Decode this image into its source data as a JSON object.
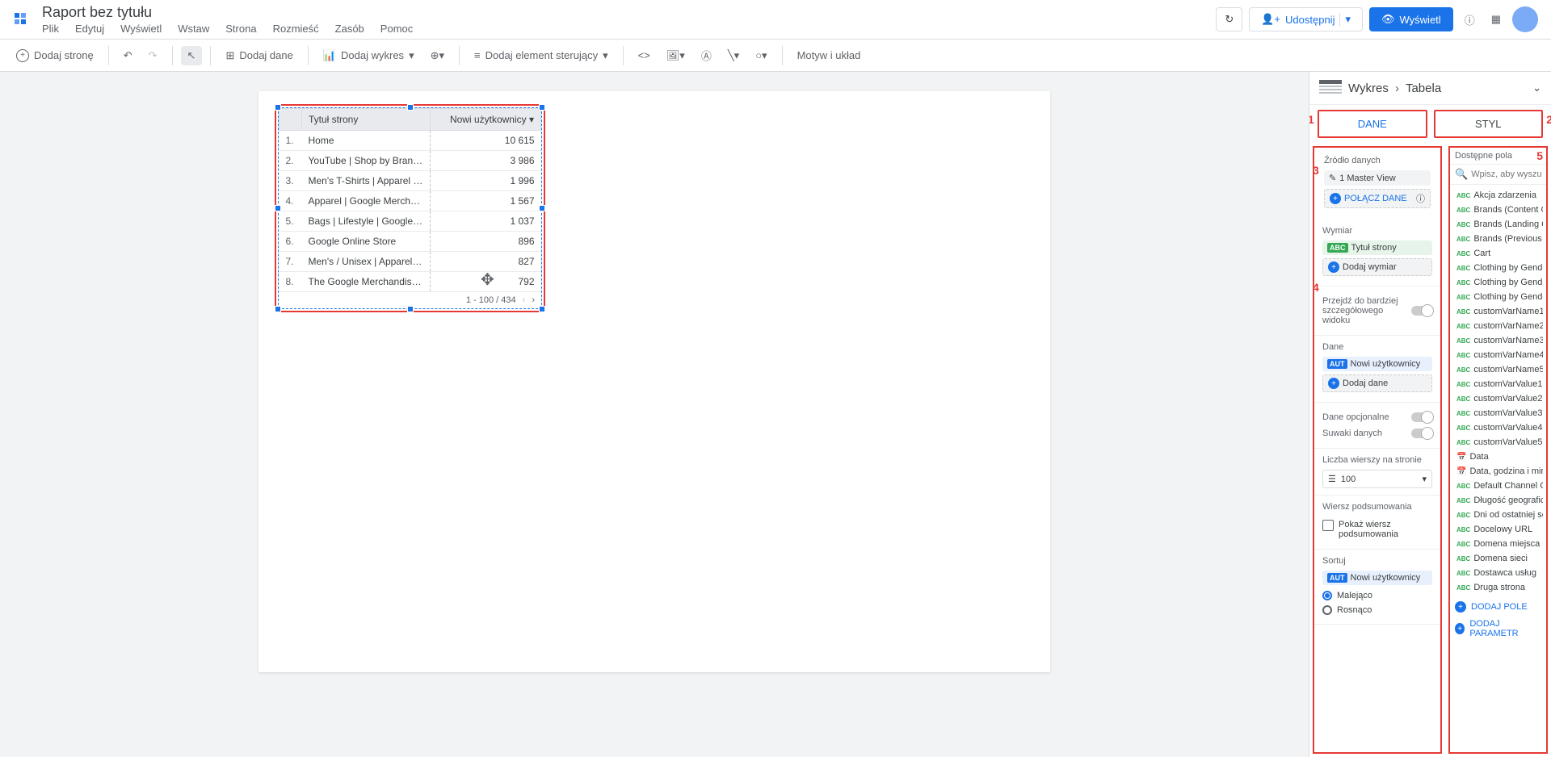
{
  "header": {
    "report_title": "Raport bez tytułu",
    "menu": [
      "Plik",
      "Edytuj",
      "Wyświetl",
      "Wstaw",
      "Strona",
      "Rozmieść",
      "Zasób",
      "Pomoc"
    ],
    "share": "Udostępnij",
    "view": "Wyświetl"
  },
  "toolbar": {
    "add_page": "Dodaj stronę",
    "add_data": "Dodaj dane",
    "add_chart": "Dodaj wykres",
    "add_control": "Dodaj element sterujący",
    "theme": "Motyw i układ"
  },
  "table": {
    "col1": "Tytuł strony",
    "col2": "Nowi użytkownicy",
    "rows": [
      {
        "n": "1.",
        "title": "Home",
        "val": "10 615"
      },
      {
        "n": "2.",
        "title": "YouTube | Shop by Brand | ...",
        "val": "3 986"
      },
      {
        "n": "3.",
        "title": "Men's T-Shirts | Apparel | G...",
        "val": "1 996"
      },
      {
        "n": "4.",
        "title": "Apparel | Google Merchand...",
        "val": "1 567"
      },
      {
        "n": "5.",
        "title": "Bags | Lifestyle | Google M...",
        "val": "1 037"
      },
      {
        "n": "6.",
        "title": "Google Online Store",
        "val": "896"
      },
      {
        "n": "7.",
        "title": "Men's / Unisex | Apparel | G...",
        "val": "827"
      },
      {
        "n": "8.",
        "title": "The Google Merchandise S...",
        "val": "792"
      }
    ],
    "pagination": "1 - 100 / 434"
  },
  "panel": {
    "breadcrumb_chart": "Wykres",
    "breadcrumb_table": "Tabela",
    "tab_data": "DANE",
    "tab_style": "STYL",
    "source_title": "Źródło danych",
    "source_name": "1 Master View",
    "combine_data": "POŁĄCZ DANE",
    "dimension_title": "Wymiar",
    "dimension_field": "Tytuł strony",
    "add_dimension": "Dodaj wymiar",
    "drill_down": "Przejdź do bardziej szczegółowego widoku",
    "metric_title": "Dane",
    "metric_field": "Nowi użytkownicy",
    "add_metric": "Dodaj dane",
    "optional_data": "Dane opcjonalne",
    "data_sliders": "Suwaki danych",
    "rows_per_page": "Liczba wierszy na stronie",
    "rows_value": "100",
    "summary_row": "Wiersz podsumowania",
    "show_summary": "Pokaż wiersz podsumowania",
    "sort_title": "Sortuj",
    "sort_field": "Nowi użytkownicy",
    "sort_desc": "Malejąco",
    "sort_asc": "Rosnąco",
    "available_fields": "Dostępne pola",
    "search_placeholder": "Wpisz, aby wyszukać",
    "fields": [
      "Akcja zdarzenia",
      "Brands (Content Group)",
      "Brands (Landing Cont...",
      "Brands (Previous Con...",
      "Cart",
      "Clothing by Gender (C...",
      "Clothing by Gender (L...",
      "Clothing by Gender (P...",
      "customVarName1",
      "customVarName2",
      "customVarName3",
      "customVarName4",
      "customVarName5",
      "customVarValue1",
      "customVarValue2",
      "customVarValue3",
      "customVarValue4",
      "customVarValue5",
      "Data",
      "Data, godzina i minuty",
      "Default Channel Grou...",
      "Długość geograficzna",
      "Dni od ostatniej sesji",
      "Docelowy URL",
      "Domena miejsca doc...",
      "Domena sieci",
      "Dostawca usług",
      "Druga strona"
    ],
    "add_field_btn": "DODAJ POLE",
    "add_param_btn": "DODAJ PARAMETR"
  },
  "annotations": {
    "a1": "1",
    "a2": "2",
    "a3": "3",
    "a4": "4",
    "a5": "5"
  }
}
